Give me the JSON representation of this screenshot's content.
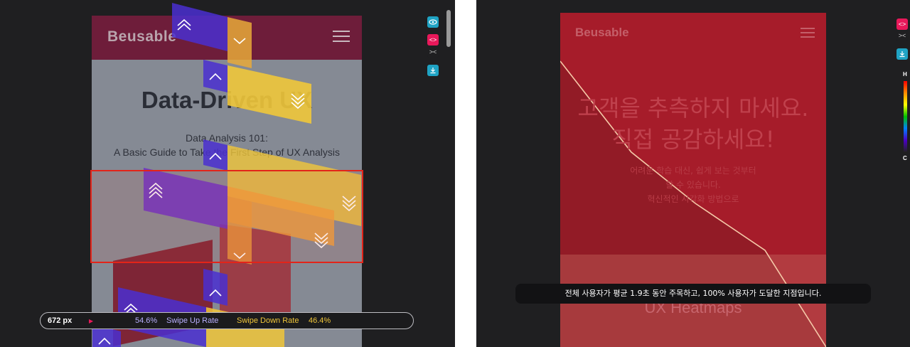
{
  "left_panel": {
    "site": {
      "logo": "Beusable",
      "hero_title": "Data-Driven UX",
      "hero_sub_line1": "Data Analysis 101:",
      "hero_sub_line2": "A Basic Guide to Take the First Step of UX Analysis"
    },
    "info_bar": {
      "position_label": "672 px",
      "swipe_up_value": "54.6%",
      "swipe_up_label": "Swipe Up Rate",
      "swipe_down_label": "Swipe Down Rate",
      "swipe_down_value": "46.4%"
    },
    "tools": {
      "view": "eye-icon",
      "code": "code-icon",
      "collapse": "collapse-icon",
      "download": "download-icon"
    },
    "colors": {
      "swipe_up": "#5a3bd6",
      "swipe_down": "#f0c63a",
      "highlight_border": "#e32419",
      "accent": "#e8185a",
      "teal": "#1fa3c4"
    }
  },
  "right_panel": {
    "site": {
      "logo": "Beusable",
      "title_line1": "고객을 추측하지 마세요.",
      "title_line2": "직접 공감하세요!",
      "desc_line1": "어려운 학습 대신, 쉽게 보는 것부터",
      "desc_line2": "할 수 있습니다.",
      "desc_line3": "혁신적인 시각화 방법으로",
      "section_title": "UX Heatmaps"
    },
    "tooltip": "전체 사용자가 평균 1.9초 동안 주목하고, 100% 사용자가 도달한 지점입니다.",
    "legend": {
      "high_label": "H",
      "low_label": "C"
    },
    "tools": {
      "code": "code-icon",
      "collapse": "collapse-icon",
      "download": "download-icon"
    },
    "colors": {
      "heat_overlay": "#a61c2a",
      "reach_line": "#f5c9a8"
    }
  }
}
